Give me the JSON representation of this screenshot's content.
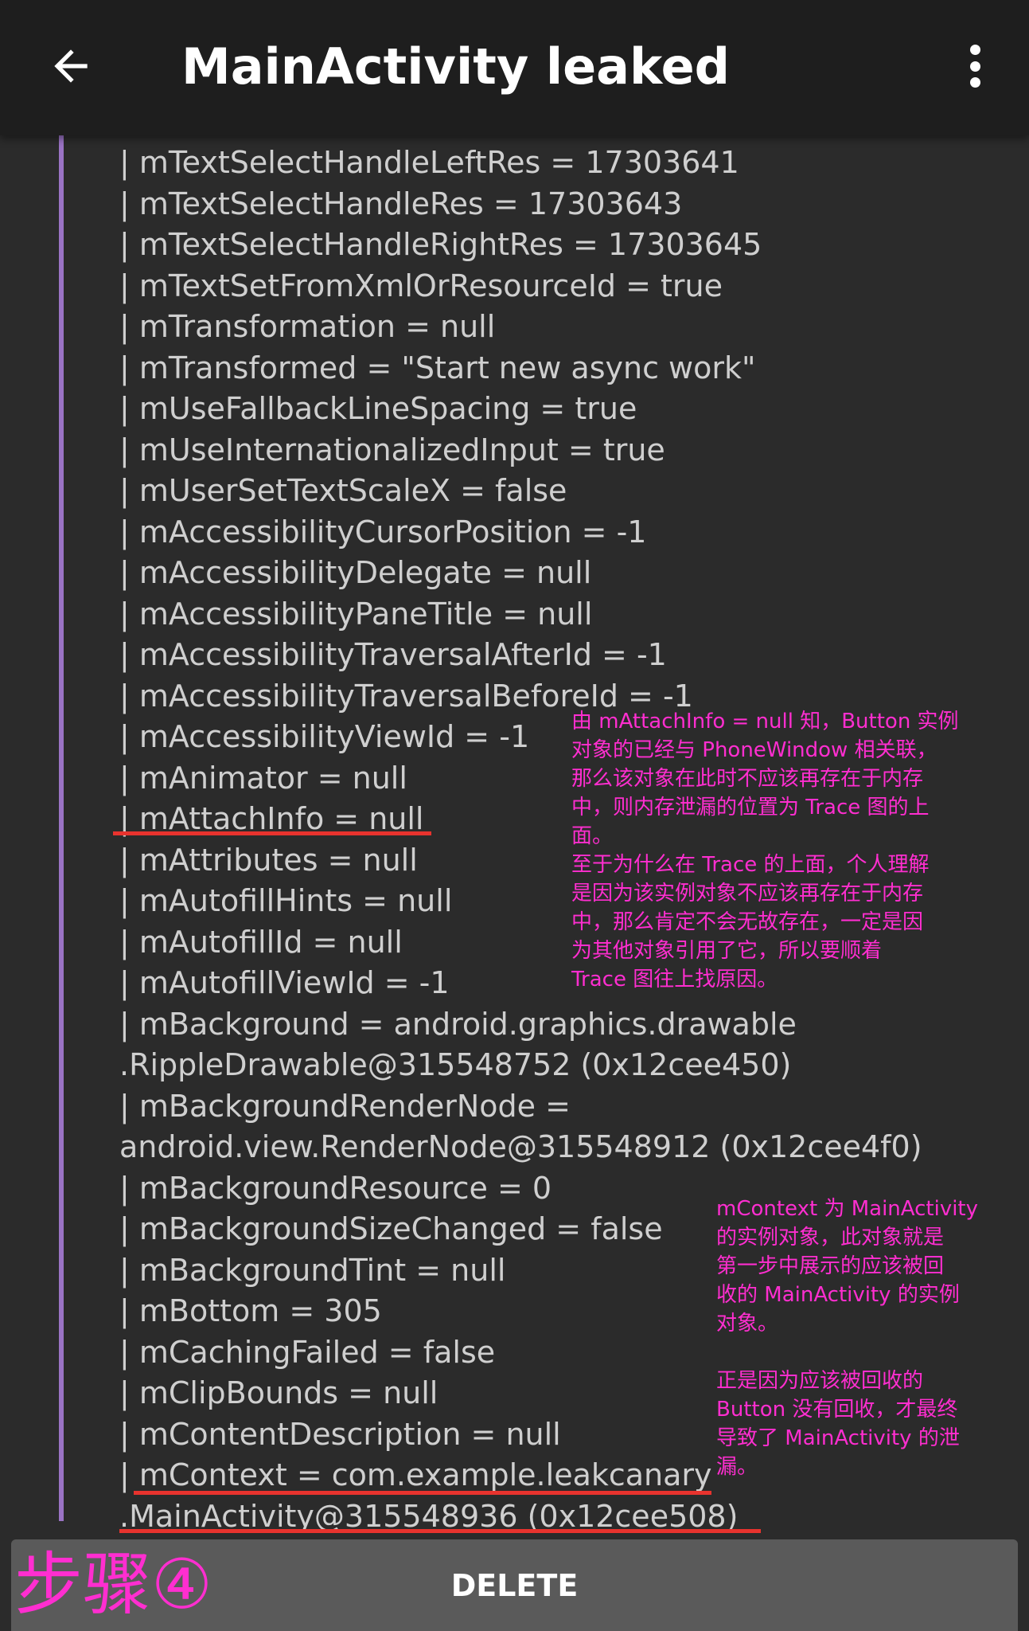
{
  "appbar": {
    "title": "MainActivity leaked",
    "back_icon": "arrow-left-icon",
    "overflow_icon": "more-vertical-icon"
  },
  "trace": {
    "lines": [
      "| mTextSelectHandleLeftRes = 17303641",
      "| mTextSelectHandleRes = 17303643",
      "| mTextSelectHandleRightRes = 17303645",
      "| mTextSetFromXmlOrResourceId = true",
      "| mTransformation = null",
      "| mTransformed = \"Start new async work\"",
      "| mUseFallbackLineSpacing = true",
      "| mUseInternationalizedInput = true",
      "| mUserSetTextScaleX = false",
      "| mAccessibilityCursorPosition = -1",
      "| mAccessibilityDelegate = null",
      "| mAccessibilityPaneTitle = null",
      "| mAccessibilityTraversalAfterId = -1",
      "| mAccessibilityTraversalBeforeId = -1",
      "| mAccessibilityViewId = -1",
      "| mAnimator = null",
      "| mAttachInfo = null",
      "| mAttributes = null",
      "| mAutofillHints = null",
      "| mAutofillId = null",
      "| mAutofillViewId = -1",
      "| mBackground = android.graphics.drawable",
      ".RippleDrawable@315548752 (0x12cee450)",
      "| mBackgroundRenderNode =",
      "android.view.RenderNode@315548912 (0x12cee4f0)",
      "| mBackgroundResource = 0",
      "| mBackgroundSizeChanged = false",
      "| mBackgroundTint = null",
      "| mBottom = 305",
      "| mCachingFailed = false",
      "| mClipBounds = null",
      "| mContentDescription = null",
      "| mContext = com.example.leakcanary",
      ".MainActivity@315548936 (0x12cee508)"
    ]
  },
  "annotations": {
    "attach_info_note": [
      "由 mAttachInfo = null 知，Button 实例",
      "对象的已经与 PhoneWindow 相关联，",
      "那么该对象在此时不应该再存在于内存",
      "中，则内存泄漏的位置为 Trace 图的上",
      "面。",
      "至于为什么在 Trace 的上面，个人理解",
      "是因为该实例对象不应该再存在于内存",
      "中，那么肯定不会无故存在，一定是因",
      "为其他对象引用了它，所以要顺着",
      "Trace 图往上找原因。"
    ],
    "context_note": [
      "mContext 为 MainActivity",
      "的实例对象，此对象就是",
      "第一步中展示的应该被回",
      "收的 MainActivity 的实例",
      "对象。",
      "",
      "正是因为应该被回收的",
      "Button 没有回收，才最终",
      "导致了 MainActivity 的泄",
      "漏。"
    ],
    "step_label": "步骤④"
  },
  "bottom_bar": {
    "delete_label": "DELETE"
  },
  "colors": {
    "annotation": "#ff2ed0",
    "underline": "#e8332e",
    "trace_line": "#9a73c4"
  }
}
